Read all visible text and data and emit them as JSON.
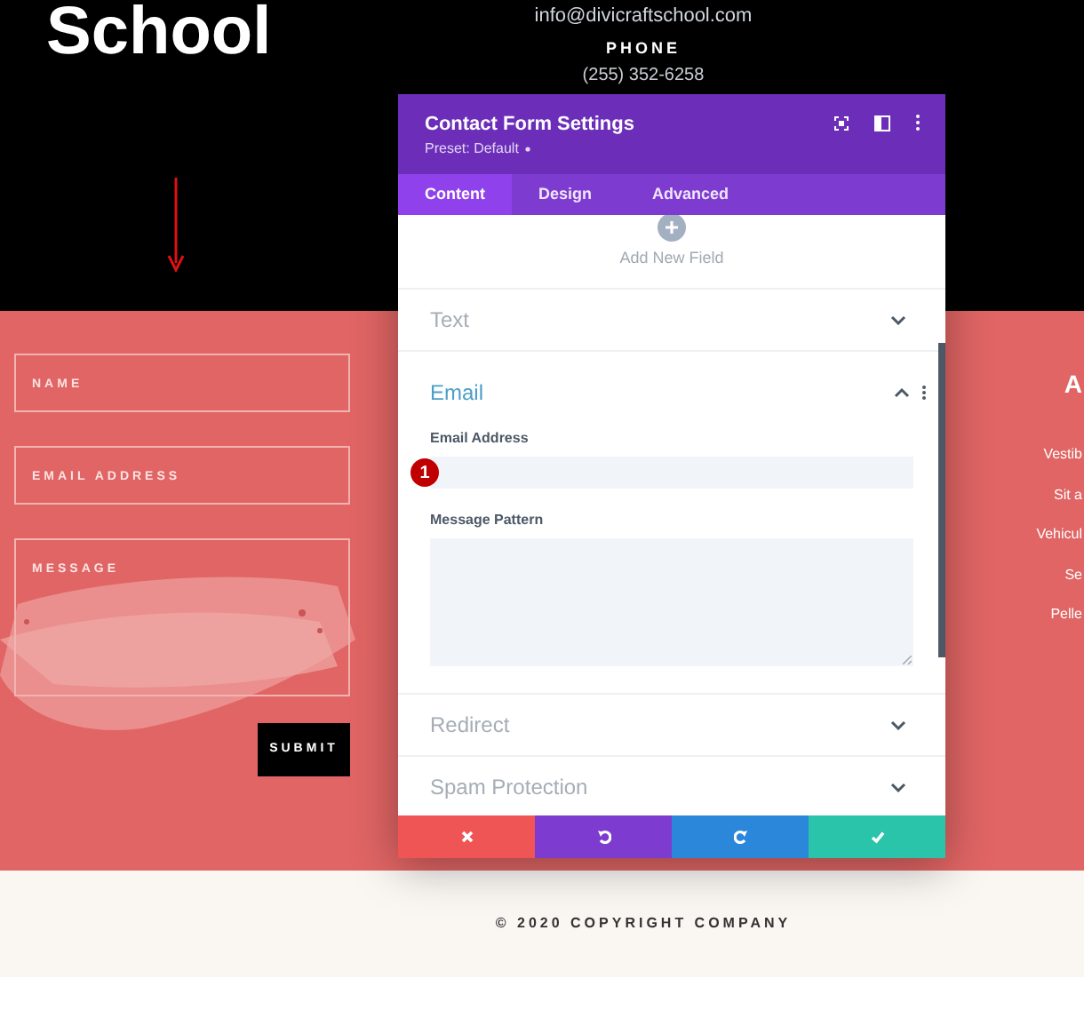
{
  "header": {
    "logo_text": "School",
    "email": "info@divicraftschool.com",
    "phone_label": "PHONE",
    "phone": "(255) 352-6258"
  },
  "contact_form": {
    "fields": [
      {
        "kind": "input",
        "placeholder": "NAME"
      },
      {
        "kind": "input",
        "placeholder": "EMAIL ADDRESS"
      },
      {
        "kind": "textarea",
        "placeholder": "MESSAGE"
      }
    ],
    "submit": "SUBMIT"
  },
  "side_column": {
    "heading": "A",
    "lines": [
      "Vestib",
      "Sit a",
      "Vehicul",
      "Se",
      "Pelle"
    ]
  },
  "settings_panel": {
    "title": "Contact Form Settings",
    "preset": "Preset: Default",
    "tabs": [
      {
        "label": "Content",
        "selected": true
      },
      {
        "label": "Design",
        "selected": false
      },
      {
        "label": "Advanced",
        "selected": false
      }
    ],
    "add_field": "Add New Field",
    "sections": [
      {
        "title": "Text",
        "expanded": false
      },
      {
        "title": "Email",
        "expanded": true,
        "fields": [
          {
            "kind": "input",
            "label": "Email Address",
            "annotation": "1"
          },
          {
            "kind": "textarea",
            "label": "Message Pattern"
          }
        ]
      },
      {
        "title": "Redirect",
        "expanded": false
      },
      {
        "title": "Spam Protection",
        "expanded": false
      }
    ],
    "actions": [
      {
        "kind": "cancel"
      },
      {
        "kind": "undo"
      },
      {
        "kind": "redo"
      },
      {
        "kind": "save"
      }
    ]
  },
  "footer": {
    "copyright": "© 2020 COPYRIGHT COMPANY"
  }
}
